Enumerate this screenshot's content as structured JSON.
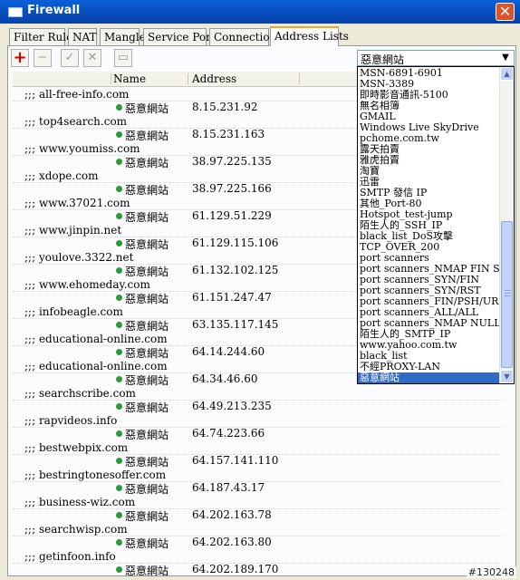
{
  "window": {
    "title": "Firewall"
  },
  "tabs": [
    "Filter Rules",
    "NAT",
    "Mangle",
    "Service Ports",
    "Connections",
    "Address Lists"
  ],
  "active_tab": "Address Lists",
  "toolbar": {
    "add": "+",
    "remove": "−",
    "enable": "✓",
    "disable": "✕",
    "comment": "▭"
  },
  "columns": {
    "name": "Name",
    "address": "Address"
  },
  "filter": {
    "selected": "惡意網站"
  },
  "rows": [
    {
      "comment": ";;; all-free-info.com",
      "name": "惡意網站",
      "address": "8.15.231.92"
    },
    {
      "comment": ";;; top4search.com",
      "name": "惡意網站",
      "address": "8.15.231.163"
    },
    {
      "comment": ";;; www.youmiss.com",
      "name": "惡意網站",
      "address": "38.97.225.135"
    },
    {
      "comment": ";;; xdope.com",
      "name": "惡意網站",
      "address": "38.97.225.166"
    },
    {
      "comment": ";;; www.37021.com",
      "name": "惡意網站",
      "address": "61.129.51.229"
    },
    {
      "comment": ";;; www.jinpin.net",
      "name": "惡意網站",
      "address": "61.129.115.106"
    },
    {
      "comment": ";;; youlove.3322.net",
      "name": "惡意網站",
      "address": "61.132.102.125"
    },
    {
      "comment": ";;; www.ehomeday.com",
      "name": "惡意網站",
      "address": "61.151.247.47"
    },
    {
      "comment": ";;; infobeagle.com",
      "name": "惡意網站",
      "address": "63.135.117.145"
    },
    {
      "comment": ";;; educational-online.com",
      "name": "惡意網站",
      "address": "64.14.244.60"
    },
    {
      "comment": ";;; educational-online.com",
      "name": "惡意網站",
      "address": "64.34.46.60"
    },
    {
      "comment": ";;; searchscribe.com",
      "name": "惡意網站",
      "address": "64.49.213.235"
    },
    {
      "comment": ";;; rapvideos.info",
      "name": "惡意網站",
      "address": "64.74.223.66"
    },
    {
      "comment": ";;; bestwebpix.com",
      "name": "惡意網站",
      "address": "64.157.141.110"
    },
    {
      "comment": ";;; bestringtonesoffer.com",
      "name": "惡意網站",
      "address": "64.187.43.17"
    },
    {
      "comment": ";;; business-wiz.com",
      "name": "惡意網站",
      "address": "64.202.163.78"
    },
    {
      "comment": ";;; searchwisp.com",
      "name": "惡意網站",
      "address": "64.202.163.80"
    },
    {
      "comment": ";;; getinfoon.info",
      "name": "惡意網站",
      "address": "64.202.189.170"
    }
  ],
  "dropdown_options": [
    "MSN-6891-6901",
    "MSN-3389",
    "即時影音通訊-5100",
    "無名相簿",
    "GMAIL",
    "Windows Live SkyDrive",
    "pchome.com.tw",
    "露天拍賣",
    "雅虎拍賣",
    "淘寶",
    "迅雷",
    "SMTP 發信 IP",
    "其他_Port-80",
    "Hotspot_test-jump",
    "陌生人的_SSH_IP",
    "black_list_DoS攻擊",
    "TCP_OVER_200",
    "port scanners",
    "port scanners_NMAP FIN Stealth",
    "port scanners_SYN/FIN",
    "port scanners_SYN/RST",
    "port scanners_FIN/PSH/URG",
    "port scanners_ALL/ALL",
    "port scanners_NMAP NULL",
    "陌生人的_SMTP_IP",
    "www.yahoo.com.tw",
    "black_list",
    "不經PROXY-LAN",
    "惡意網站"
  ],
  "watermark": "#130248",
  "colors": {
    "title_bar": "#0a5fd8",
    "selection": "#316ac5",
    "enabled_dot": "#2c9a36",
    "close_button": "#d9532c"
  }
}
